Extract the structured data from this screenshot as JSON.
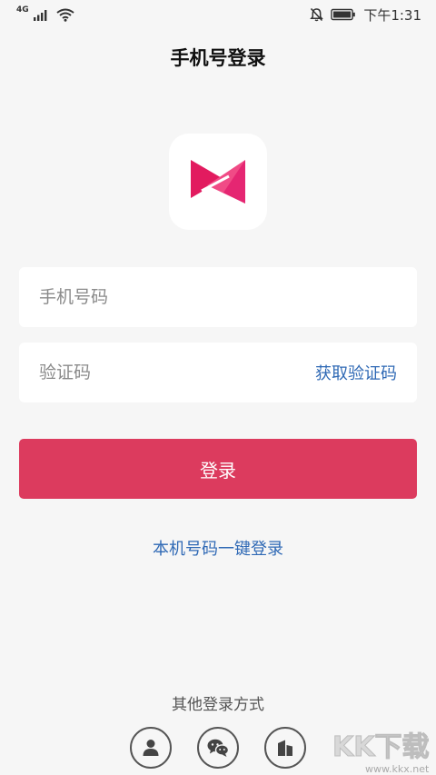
{
  "status_bar": {
    "network": "4G",
    "time": "下午1:31",
    "icons": [
      "signal-icon",
      "wifi-icon",
      "mute-bell-icon",
      "battery-icon"
    ]
  },
  "page": {
    "title": "手机号登录"
  },
  "logo": {
    "icon": "app-logo-icon",
    "colors": {
      "primary": "#e21b5f",
      "secondary": "#f04b86"
    }
  },
  "form": {
    "phone_placeholder": "手机号码",
    "code_placeholder": "验证码",
    "get_code_label": "获取验证码",
    "login_label": "登录",
    "one_key_label": "本机号码一键登录"
  },
  "other_login": {
    "label": "其他登录方式",
    "methods": [
      "user-icon",
      "wechat-icon",
      "building-icon"
    ]
  },
  "watermark": {
    "text": "KK下载",
    "url": "www.kkx.net"
  },
  "colors": {
    "accent": "#dc3b5e",
    "link": "#2f69b5",
    "background": "#f6f6f6"
  }
}
